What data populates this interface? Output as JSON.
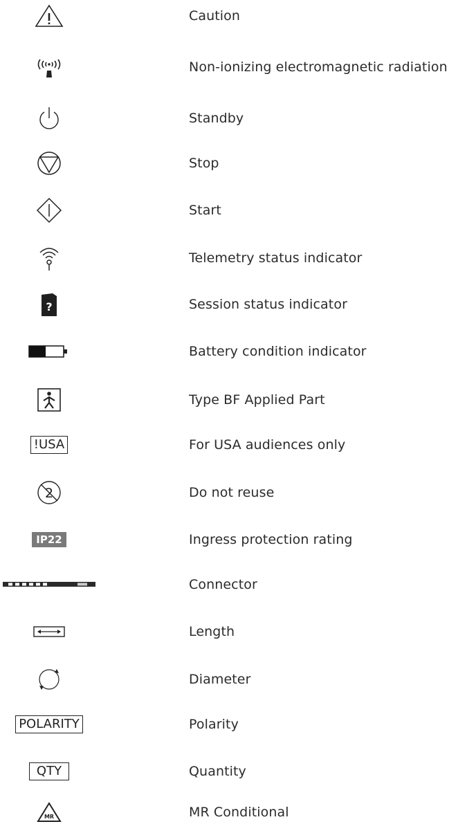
{
  "symbols": [
    {
      "icon": "caution-icon",
      "label": "Caution"
    },
    {
      "icon": "radiation-icon",
      "label": "Non-ionizing electromagnetic radiation"
    },
    {
      "icon": "standby-icon",
      "label": "Standby"
    },
    {
      "icon": "stop-icon",
      "label": "Stop"
    },
    {
      "icon": "start-icon",
      "label": "Start"
    },
    {
      "icon": "telemetry-icon",
      "label": "Telemetry status indicator"
    },
    {
      "icon": "session-icon",
      "label": "Session status indicator",
      "glyph": "?"
    },
    {
      "icon": "battery-icon",
      "label": "Battery condition indicator"
    },
    {
      "icon": "type-bf-icon",
      "label": "Type BF Applied Part"
    },
    {
      "icon": "usa-only-icon",
      "label": "For USA audiences only",
      "glyph": "!USA"
    },
    {
      "icon": "no-reuse-icon",
      "label": "Do not reuse",
      "glyph": "2"
    },
    {
      "icon": "ip-rating-icon",
      "label": "Ingress protection rating",
      "glyph": "IP22"
    },
    {
      "icon": "connector-icon",
      "label": "Connector"
    },
    {
      "icon": "length-icon",
      "label": "Length"
    },
    {
      "icon": "diameter-icon",
      "label": "Diameter"
    },
    {
      "icon": "polarity-icon",
      "label": "Polarity",
      "glyph": "POLARITY"
    },
    {
      "icon": "quantity-icon",
      "label": "Quantity",
      "glyph": "QTY"
    },
    {
      "icon": "mr-conditional-icon",
      "label": "MR Conditional",
      "glyph": "MR"
    }
  ],
  "colors": {
    "text": "#2b2b2b",
    "ip_badge": "#7a7a7a"
  }
}
